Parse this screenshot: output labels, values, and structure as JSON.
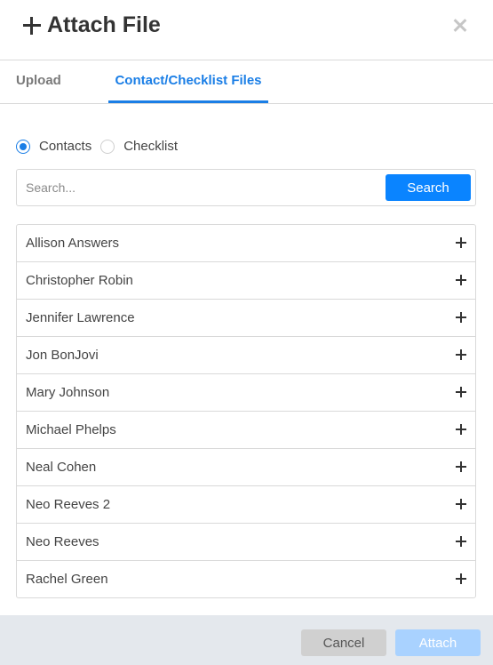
{
  "dialog": {
    "title": "Attach File",
    "close_icon": "close-icon"
  },
  "tabs": [
    {
      "label": "Upload",
      "active": false
    },
    {
      "label": "Contact/Checklist Files",
      "active": true
    }
  ],
  "source_options": [
    {
      "label": "Contacts",
      "selected": true
    },
    {
      "label": "Checklist",
      "selected": false
    }
  ],
  "search": {
    "placeholder": "Search...",
    "value": "",
    "button_label": "Search"
  },
  "contacts": [
    {
      "name": "Allison Answers"
    },
    {
      "name": "Christopher Robin"
    },
    {
      "name": "Jennifer Lawrence"
    },
    {
      "name": "Jon BonJovi"
    },
    {
      "name": "Mary Johnson"
    },
    {
      "name": "Michael Phelps"
    },
    {
      "name": "Neal Cohen"
    },
    {
      "name": "Neo Reeves 2"
    },
    {
      "name": "Neo Reeves"
    },
    {
      "name": "Rachel Green"
    }
  ],
  "footer": {
    "cancel_label": "Cancel",
    "attach_label": "Attach",
    "attach_enabled": false
  },
  "colors": {
    "accent": "#1a7ee6",
    "search_button": "#0a84ff",
    "attach_disabled": "#a9d2ff",
    "footer_bg": "#e4e8ed"
  }
}
